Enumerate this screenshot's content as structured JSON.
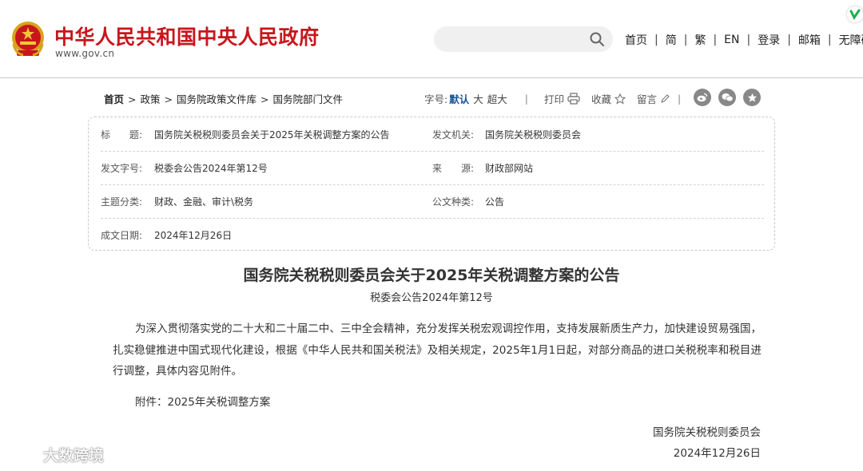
{
  "header": {
    "site_title": "中华人民共和国中央人民政府",
    "site_url": "www.gov.cn",
    "search_placeholder": "",
    "nav": [
      "首页",
      "简",
      "繁",
      "EN",
      "登录",
      "邮箱",
      "无障碍"
    ]
  },
  "breadcrumb": [
    "首页",
    "政策",
    "国务院政策文件库",
    "国务院部门文件"
  ],
  "tools": {
    "font_size_label": "字号:",
    "font_sizes": [
      "默认",
      "大",
      "超大"
    ],
    "print": "打印",
    "favorite": "收藏",
    "comment": "留言"
  },
  "share": [
    "weibo-icon",
    "wechat-icon",
    "favorite-star-icon"
  ],
  "info": {
    "rows": [
      {
        "l1": "标　　题:",
        "v1": "国务院关税税则委员会关于2025年关税调整方案的公告",
        "l2": "发文机关:",
        "v2": "国务院关税税则委员会"
      },
      {
        "l1": "发文字号:",
        "v1": "税委会公告2024年第12号",
        "l2": "来　　源:",
        "v2": "财政部网站"
      },
      {
        "l1": "主题分类:",
        "v1": "财政、金融、审计\\税务",
        "l2": "公文种类:",
        "v2": "公告"
      },
      {
        "l1": "成文日期:",
        "v1": "2024年12月26日",
        "l2": "",
        "v2": ""
      }
    ]
  },
  "article": {
    "title": "国务院关税税则委员会关于2025年关税调整方案的公告",
    "subtitle": "税委会公告2024年第12号",
    "body": "为深入贯彻落实党的二十大和二十届二中、三中全会精神，充分发挥关税宏观调控作用，支持发展新质生产力，加快建设贸易强国，扎实稳健推进中国式现代化建设，根据《中华人民共和国关税法》及相关规定，2025年1月1日起，对部分商品的进口关税税率和税目进行调整，具体内容见附件。",
    "attachment": "附件：2025年关税调整方案",
    "signer": "国务院关税税则委员会",
    "date": "2024年12月26日"
  },
  "watermark": "大数跨境",
  "colors": {
    "brand_red": "#c8161d",
    "link_blue": "#1b5496"
  }
}
